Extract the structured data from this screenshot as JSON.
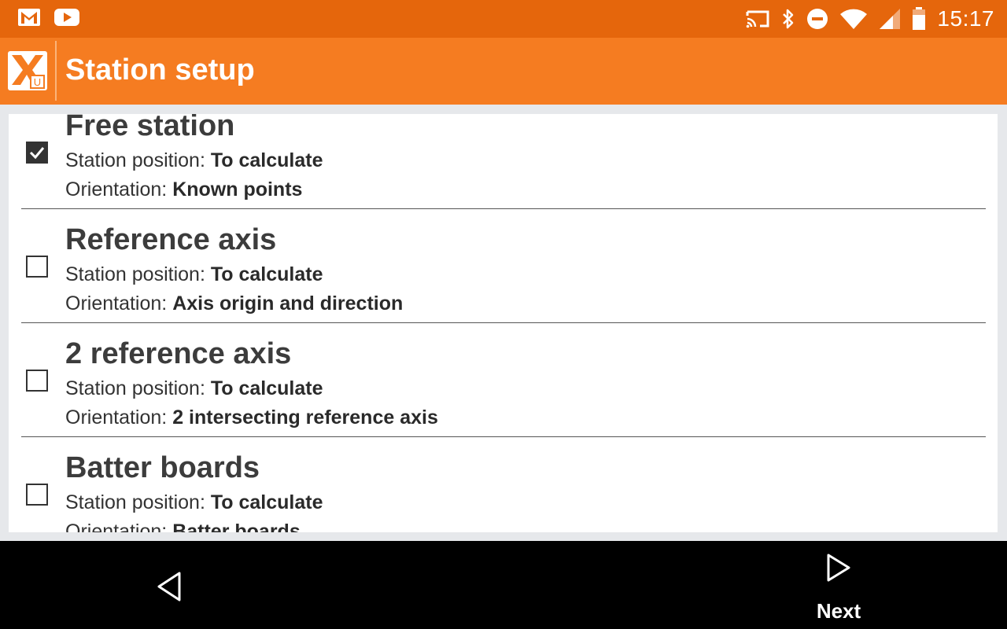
{
  "status_bar": {
    "time": "15:17",
    "left_icons": [
      "gmail-icon",
      "youtube-icon"
    ],
    "right_icons": [
      "cast-icon",
      "bluetooth-icon",
      "do-not-disturb-icon",
      "wifi-icon",
      "cell-signal-icon",
      "battery-icon"
    ]
  },
  "app_bar": {
    "title": "Station setup",
    "logo_badge": "U"
  },
  "options": [
    {
      "title": "Free station",
      "checked": true,
      "position_label": "Station position: ",
      "position_value": "To calculate",
      "orientation_label": "Orientation: ",
      "orientation_value": "Known points"
    },
    {
      "title": "Reference axis",
      "checked": false,
      "position_label": "Station position: ",
      "position_value": "To calculate",
      "orientation_label": "Orientation: ",
      "orientation_value": "Axis origin and direction"
    },
    {
      "title": "2 reference axis",
      "checked": false,
      "position_label": "Station position: ",
      "position_value": "To calculate",
      "orientation_label": "Orientation: ",
      "orientation_value": "2 intersecting reference axis"
    },
    {
      "title": "Batter boards",
      "checked": false,
      "position_label": "Station position: ",
      "position_value": "To calculate",
      "orientation_label": "Orientation: ",
      "orientation_value": "Batter boards"
    }
  ],
  "nav_bar": {
    "next_label": "Next"
  },
  "colors": {
    "status_bar": "#e5660c",
    "app_bar": "#f57c21",
    "nav_bar": "#000000"
  }
}
